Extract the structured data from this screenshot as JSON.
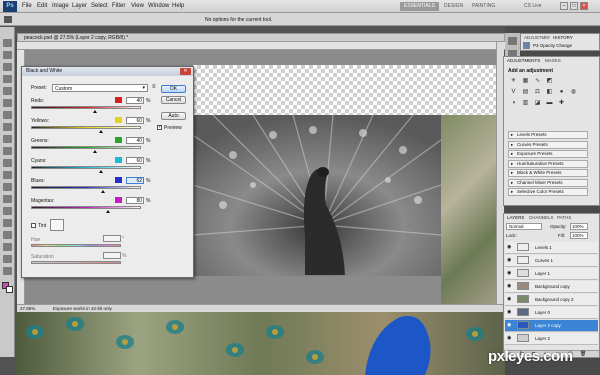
{
  "menubar": {
    "logo": "Ps",
    "items": [
      "File",
      "Edit",
      "Image",
      "Layer",
      "Select",
      "Filter",
      "View",
      "Window",
      "Help"
    ],
    "workspaces": [
      "ESSENTIALS",
      "DESIGN",
      "PAINTING"
    ],
    "cs_live": "CS Live"
  },
  "options_bar": {
    "text": "No options for the current tool."
  },
  "document": {
    "tab_title": "peacock.psd @ 27.5% (Layer 2 copy, RGB/8) *",
    "zoom": "27.55%",
    "status": "Exposure works in 32-bit only"
  },
  "bw_dialog": {
    "title": "Black and White",
    "preset_label": "Preset:",
    "preset_value": "Custom",
    "sliders": [
      {
        "label": "Reds:",
        "value": "40",
        "unit": "%",
        "color": "#d61f1f",
        "fraction": 0.58
      },
      {
        "label": "Yellows:",
        "value": "60",
        "unit": "%",
        "color": "#e6d21a",
        "fraction": 0.64
      },
      {
        "label": "Greens:",
        "value": "40",
        "unit": "%",
        "color": "#2aa52a",
        "fraction": 0.58
      },
      {
        "label": "Cyans:",
        "value": "60",
        "unit": "%",
        "color": "#1db8d6",
        "fraction": 0.64
      },
      {
        "label": "Blues:",
        "value": "62",
        "unit": "%",
        "color": "#2233c8",
        "fraction": 0.65
      },
      {
        "label": "Magentas:",
        "value": "80",
        "unit": "%",
        "color": "#c21fc2",
        "fraction": 0.7
      }
    ],
    "tint_label": "Tint",
    "hue_label": "Hue",
    "hue_unit": "°",
    "saturation_label": "Saturation",
    "saturation_unit": "%",
    "ok": "OK",
    "cancel": "Cancel",
    "auto": "Auto",
    "preview": "Preview"
  },
  "history_panel": {
    "tabs": [
      "ADJUSTMENTS",
      "HISTORY"
    ],
    "item": "P3 Opacity Change"
  },
  "adjustments_panel": {
    "tabs": [
      "ADJUSTMENTS",
      "MASKS"
    ],
    "header": "Add an adjustment",
    "presets": [
      "Levels Presets",
      "Curves Presets",
      "Exposure Presets",
      "Hue/Saturation Presets",
      "Black & White Presets",
      "Channel Mixer Presets",
      "Selective Color Presets"
    ]
  },
  "layers_panel": {
    "tabs": [
      "LAYERS",
      "CHANNELS",
      "PATHS"
    ],
    "blend_mode": "Normal",
    "opacity_label": "Opacity:",
    "opacity_value": "100%",
    "lock_label": "Lock:",
    "fill_label": "Fill:",
    "fill_value": "100%",
    "layers": [
      {
        "name": "Levels 1",
        "selected": false
      },
      {
        "name": "Curves 1",
        "selected": false
      },
      {
        "name": "Layer 1",
        "selected": false
      },
      {
        "name": "Background copy",
        "selected": false
      },
      {
        "name": "Background copy 2",
        "selected": false
      },
      {
        "name": "Layer 0",
        "selected": false
      },
      {
        "name": "Layer 2 copy",
        "selected": true
      },
      {
        "name": "Layer 2",
        "selected": false
      }
    ]
  },
  "watermark": "pxleyes.com",
  "colors": {
    "accent_blue": "#3b84d6",
    "close_red": "#c9433a",
    "panel_gray": "#e4e4e4"
  }
}
